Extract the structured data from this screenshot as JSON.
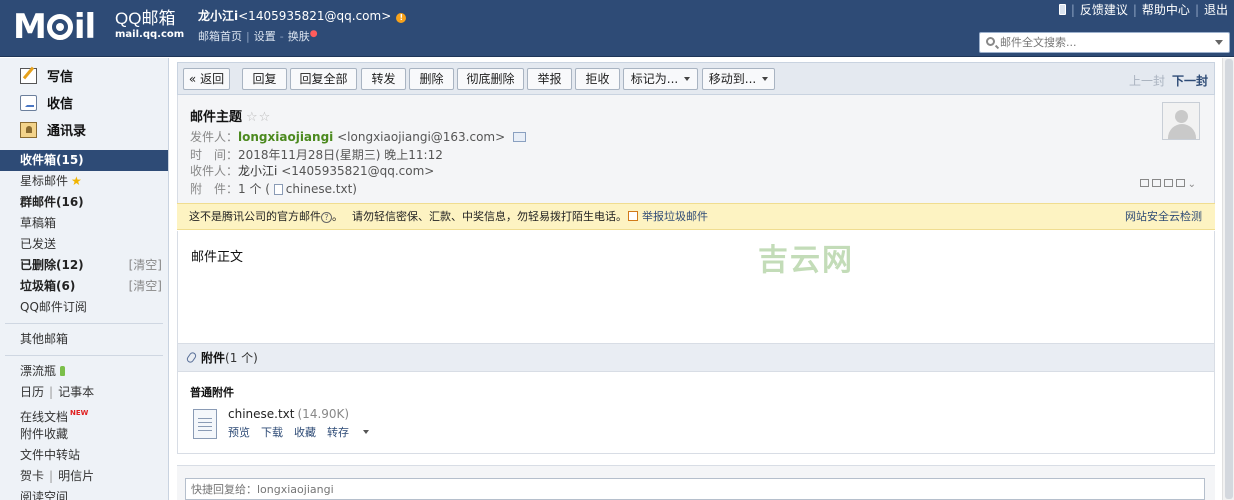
{
  "header": {
    "logo_left": "M",
    "logo_right": "il",
    "logo_sub1": "QQ邮箱",
    "logo_sub2": "mail.qq.com",
    "user_name": "龙小江i",
    "user_email": "<1405935821@qq.com>",
    "links": [
      "邮箱首页",
      "设置",
      "换肤"
    ],
    "link_sep": "|",
    "link_dash": "-",
    "top_right": [
      "反馈建议",
      "帮助中心",
      "退出"
    ],
    "search_placeholder": "邮件全文搜索...",
    "accent": "#2e4b76"
  },
  "sidebar": {
    "quick": [
      {
        "label": "写信",
        "icon": "write-icon"
      },
      {
        "label": "收信",
        "icon": "inbox-icon"
      },
      {
        "label": "通讯录",
        "icon": "contacts-icon"
      }
    ],
    "folders": {
      "inbox": "收件箱(15)",
      "starred": "星标邮件",
      "group": "群邮件(16)",
      "drafts": "草稿箱",
      "sent": "已发送",
      "deleted": "已删除(12)",
      "spam": "垃圾箱(6)",
      "clear": "[清空]",
      "subscriptions": "QQ邮件订阅",
      "other": "其他邮箱",
      "bottle": "漂流瓶",
      "calendar": "日历",
      "notes": "记事本",
      "docs": "在线文档",
      "new_tag": "NEW",
      "attach_fav": "附件收藏",
      "transfer": "文件中转站",
      "card": "贺卡",
      "postcard": "明信片",
      "reading": "阅读空间",
      "star_glyph": "★"
    }
  },
  "toolbar": {
    "back": "« 返回",
    "reply": "回复",
    "reply_all": "回复全部",
    "forward": "转发",
    "delete": "删除",
    "perm_delete": "彻底删除",
    "report": "举报",
    "reject": "拒收",
    "mark": "标记为...",
    "move": "移动到...",
    "prev": "上一封",
    "next": "下一封"
  },
  "mail": {
    "subject": "邮件主题",
    "subject_stars": "☆☆",
    "from_label": "发件人：",
    "from_name": "longxiaojiangi",
    "from_email": "<longxiaojiangi@163.com>",
    "time_label": "时　间：",
    "time_value": "2018年11月28日(星期三) 晚上11:12",
    "to_label": "收件人：",
    "to_name": "龙小江i",
    "to_email": "<1405935821@qq.com>",
    "att_label": "附　件：",
    "att_count": "1 个 (",
    "att_name": "chinese.txt",
    "att_close": ")",
    "body": "邮件正文",
    "watermark": "吉云网"
  },
  "safety": {
    "notice": "这不是腾讯公司的官方邮件",
    "q": "?",
    "warning": "请勿轻信密保、汇款、中奖信息，勿轻易拨打陌生电话。",
    "report": "举报垃圾邮件",
    "check": "网站安全云检测"
  },
  "attachments": {
    "title": "附件",
    "count": "(1 个)",
    "section": "普通附件",
    "file_name": "chinese.txt",
    "file_size": "(14.90K)",
    "actions": [
      "预览",
      "下载",
      "收藏",
      "转存"
    ]
  },
  "reply": {
    "placeholder": "快捷回复给：longxiaojiangi"
  }
}
